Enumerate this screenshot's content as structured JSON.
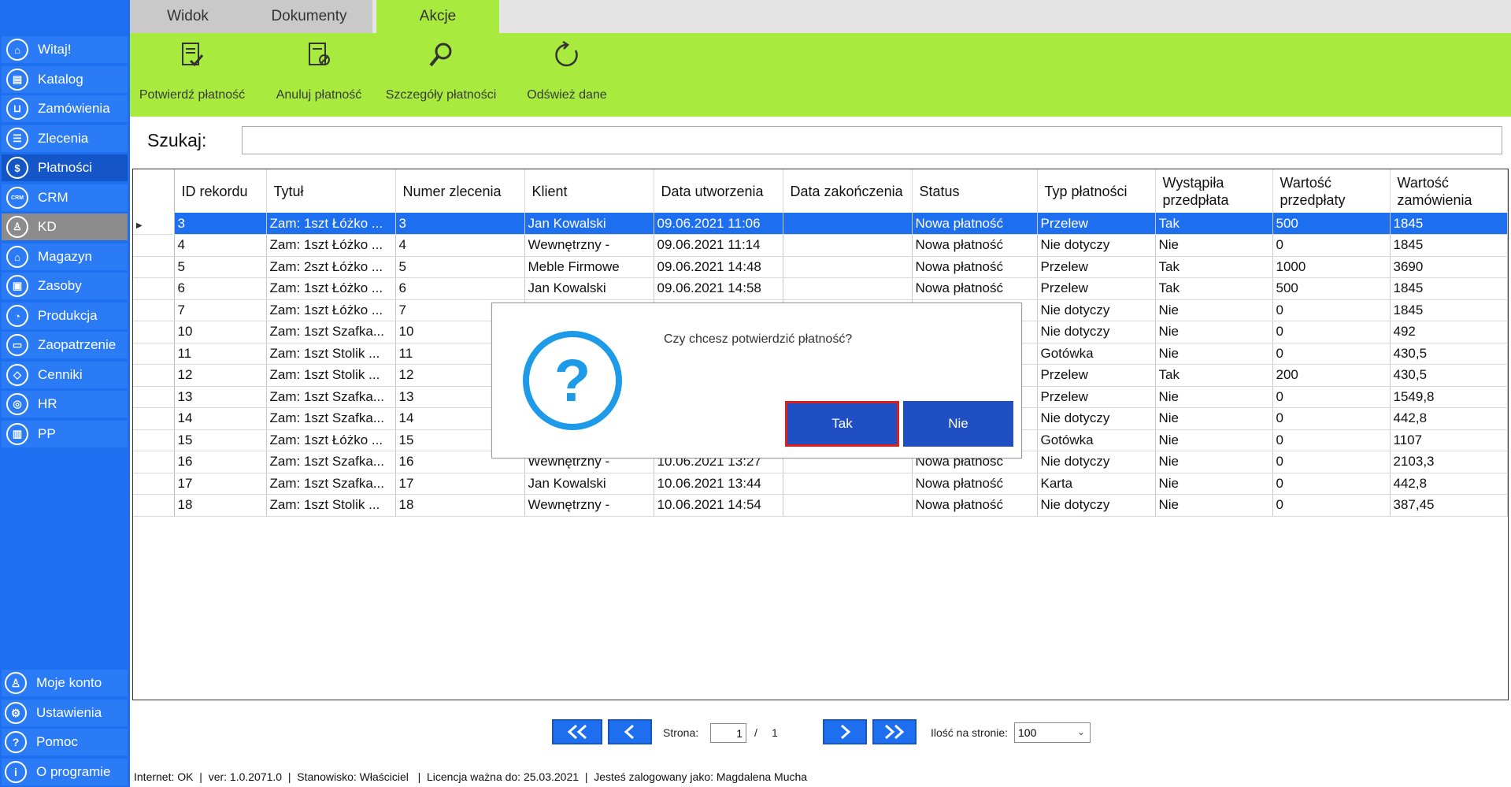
{
  "colors": {
    "accent_blue": "#1e6ff0",
    "ribbon_green": "#a8eb3e",
    "dialog_icon": "#1e9be8",
    "highlight_red": "#e21b1b"
  },
  "sidebar": {
    "items": [
      {
        "label": "Witaj!",
        "icon": "home-icon"
      },
      {
        "label": "Katalog",
        "icon": "book-icon"
      },
      {
        "label": "Zamówienia",
        "icon": "cart-icon"
      },
      {
        "label": "Zlecenia",
        "icon": "list-icon"
      },
      {
        "label": "Płatności",
        "icon": "dollar-icon"
      },
      {
        "label": "CRM",
        "icon": "crm-icon"
      },
      {
        "label": "KD",
        "icon": "user-lock-icon"
      },
      {
        "label": "Magazyn",
        "icon": "warehouse-icon"
      },
      {
        "label": "Zasoby",
        "icon": "box-icon"
      },
      {
        "label": "Produkcja",
        "icon": "gauge-icon"
      },
      {
        "label": "Zaopatrzenie",
        "icon": "truck-icon"
      },
      {
        "label": "Cenniki",
        "icon": "tag-icon"
      },
      {
        "label": "HR",
        "icon": "target-icon"
      },
      {
        "label": "PP",
        "icon": "factory-icon"
      }
    ],
    "bottom": [
      {
        "label": "Moje konto",
        "icon": "user-icon"
      },
      {
        "label": "Ustawienia",
        "icon": "gear-icon"
      },
      {
        "label": "Pomoc",
        "icon": "help-icon"
      },
      {
        "label": "O programie",
        "icon": "info-icon"
      }
    ]
  },
  "tabs": [
    "Widok",
    "Dokumenty",
    "Akcje"
  ],
  "ribbon": {
    "confirm": "Potwierdź płatność",
    "cancel": "Anuluj płatność",
    "details": "Szczegóły płatności",
    "refresh": "Odśwież dane"
  },
  "search": {
    "label": "Szukaj:",
    "value": ""
  },
  "table": {
    "headers": [
      "ID rekordu",
      "Tytuł",
      "Numer zlecenia",
      "Klient",
      "Data utworzenia",
      "Data zakończenia",
      "Status",
      "Typ płatności",
      "Wystąpiła przedpłata",
      "Wartość przedpłaty",
      "Wartość zamówienia"
    ],
    "rows": [
      [
        "3",
        "Zam: 1szt Łóżko ...",
        "3",
        "Jan Kowalski",
        "09.06.2021 11:06",
        "",
        "Nowa płatność",
        "Przelew",
        "Tak",
        "500",
        "1845"
      ],
      [
        "4",
        "Zam: 1szt Łóżko ...",
        "4",
        "Wewnętrzny -",
        "09.06.2021 11:14",
        "",
        "Nowa płatność",
        "Nie dotyczy",
        "Nie",
        "0",
        "1845"
      ],
      [
        "5",
        "Zam: 2szt Łóżko ...",
        "5",
        "Meble Firmowe",
        "09.06.2021 14:48",
        "",
        "Nowa płatność",
        "Przelew",
        "Tak",
        "1000",
        "3690"
      ],
      [
        "6",
        "Zam: 1szt Łóżko ...",
        "6",
        "Jan Kowalski",
        "09.06.2021 14:58",
        "",
        "Nowa płatność",
        "Przelew",
        "Tak",
        "500",
        "1845"
      ],
      [
        "7",
        "Zam: 1szt Łóżko ...",
        "7",
        "",
        "",
        "",
        "",
        "Nie dotyczy",
        "Nie",
        "0",
        "1845"
      ],
      [
        "10",
        "Zam: 1szt Szafka...",
        "10",
        "",
        "",
        "",
        "",
        "Nie dotyczy",
        "Nie",
        "0",
        "492"
      ],
      [
        "11",
        "Zam: 1szt Stolik ...",
        "11",
        "",
        "",
        "",
        "",
        "Gotówka",
        "Nie",
        "0",
        "430,5"
      ],
      [
        "12",
        "Zam: 1szt Stolik ...",
        "12",
        "",
        "",
        "",
        "",
        "Przelew",
        "Tak",
        "200",
        "430,5"
      ],
      [
        "13",
        "Zam: 1szt Szafka...",
        "13",
        "",
        "",
        "",
        "",
        "Przelew",
        "Nie",
        "0",
        "1549,8"
      ],
      [
        "14",
        "Zam: 1szt Szafka...",
        "14",
        "",
        "",
        "",
        "",
        "Nie dotyczy",
        "Nie",
        "0",
        "442,8"
      ],
      [
        "15",
        "Zam: 1szt Łóżko ...",
        "15",
        "",
        "",
        "",
        "",
        "Gotówka",
        "Nie",
        "0",
        "1107"
      ],
      [
        "16",
        "Zam: 1szt Szafka...",
        "16",
        "Wewnętrzny -",
        "10.06.2021 13:27",
        "",
        "Nowa płatność",
        "Nie dotyczy",
        "Nie",
        "0",
        "2103,3"
      ],
      [
        "17",
        "Zam: 1szt Szafka...",
        "17",
        "Jan Kowalski",
        "10.06.2021 13:44",
        "",
        "Nowa płatność",
        "Karta",
        "Nie",
        "0",
        "442,8"
      ],
      [
        "18",
        "Zam: 1szt Stolik ...",
        "18",
        "Wewnętrzny -",
        "10.06.2021 14:54",
        "",
        "Nowa płatność",
        "Nie dotyczy",
        "Nie",
        "0",
        "387,45"
      ]
    ]
  },
  "pager": {
    "page_label": "Strona:",
    "page": "1",
    "separator": "/",
    "total": "1",
    "per_page_label": "Ilość na stronie:",
    "per_page": "100"
  },
  "status": {
    "internet": "Internet: OK",
    "version": "ver: 1.0.2071.0",
    "position": "Stanowisko: Właściciel",
    "license": "Licencja ważna do: 25.03.2021",
    "user": "Jesteś zalogowany jako: Magdalena Mucha"
  },
  "dialog": {
    "message": "Czy chcesz potwierdzić płatność?",
    "yes": "Tak",
    "no": "Nie",
    "icon": "question-icon"
  }
}
